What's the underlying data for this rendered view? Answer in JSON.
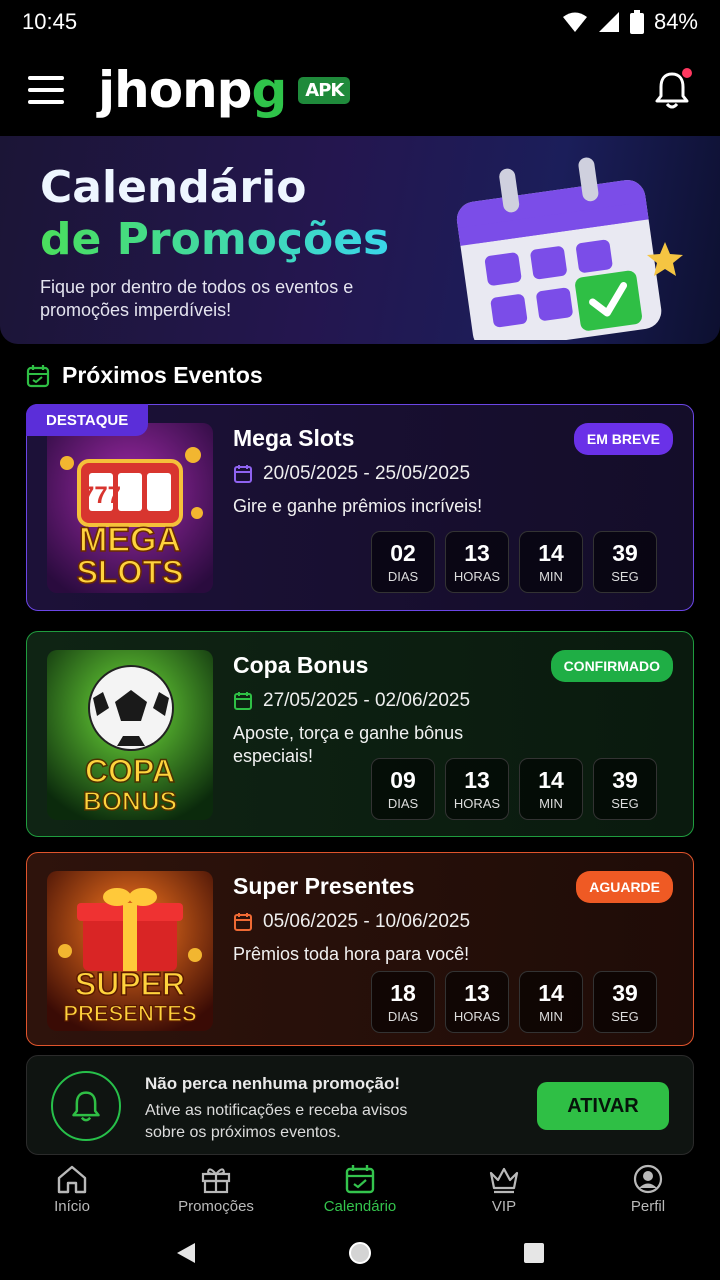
{
  "status": {
    "time": "10:45",
    "battery": "84%"
  },
  "app": {
    "logo_main": "jhonp",
    "logo_accent": "g",
    "apk_badge": "APK"
  },
  "banner": {
    "title_line1": "Calendário",
    "title_line2": "de Promoções",
    "subtitle": "Fique por dentro de todos os eventos e promoções imperdíveis!"
  },
  "section": {
    "title": "Próximos Eventos"
  },
  "events": [
    {
      "featured_label": "DESTAQUE",
      "title": "Mega Slots",
      "status": "EM BREVE",
      "status_color": "#6a31e8",
      "dates": "20/05/2025 - 25/05/2025",
      "description": "Gire e ganhe prêmios incríveis!",
      "thumb_line1": "MEGA",
      "thumb_line2": "SLOTS",
      "thumb_icon": "777",
      "countdown": {
        "days": "02",
        "hours": "13",
        "min": "14",
        "sec": "39"
      }
    },
    {
      "title": "Copa Bonus",
      "status": "CONFIRMADO",
      "status_color": "#1fae45",
      "dates": "27/05/2025 - 02/06/2025",
      "description": "Aposte, torça e ganhe bônus especiais!",
      "thumb_line1": "COPA",
      "thumb_line2": "BONUS",
      "countdown": {
        "days": "09",
        "hours": "13",
        "min": "14",
        "sec": "39"
      }
    },
    {
      "title": "Super Presentes",
      "status": "AGUARDE",
      "status_color": "#ef5a24",
      "dates": "05/06/2025 - 10/06/2025",
      "description": "Prêmios toda hora para você!",
      "thumb_line1": "SUPER",
      "thumb_line2": "PRESENTES",
      "countdown": {
        "days": "18",
        "hours": "13",
        "min": "14",
        "sec": "39"
      }
    }
  ],
  "countdown_labels": {
    "days": "DIAS",
    "hours": "HORAS",
    "min": "MIN",
    "sec": "SEG"
  },
  "notification": {
    "title": "Não perca nenhuma promoção!",
    "text": "Ative as notificações e receba avisos sobre os próximos eventos.",
    "button": "ATIVAR"
  },
  "nav": [
    {
      "label": "Início",
      "icon": "home-icon"
    },
    {
      "label": "Promoções",
      "icon": "gift-icon"
    },
    {
      "label": "Calendário",
      "icon": "calendar-icon",
      "active": true
    },
    {
      "label": "VIP",
      "icon": "crown-icon"
    },
    {
      "label": "Perfil",
      "icon": "user-icon"
    }
  ],
  "colors": {
    "accent": "#34c44d",
    "background": "#000000"
  }
}
